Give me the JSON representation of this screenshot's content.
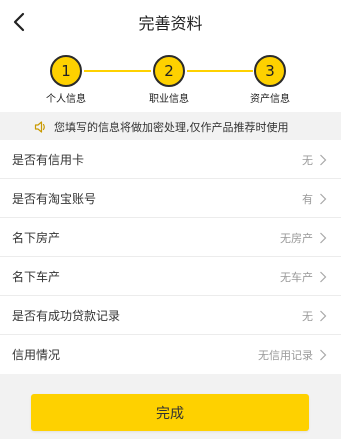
{
  "header": {
    "title": "完善资料",
    "back_icon": "chevron-left-icon"
  },
  "steps": [
    {
      "number": "1",
      "label": "个人信息"
    },
    {
      "number": "2",
      "label": "职业信息"
    },
    {
      "number": "3",
      "label": "资产信息"
    }
  ],
  "notice": {
    "icon": "speaker-icon",
    "text": "您填写的信息将做加密处理,仅作产品推荐时使用"
  },
  "fields": [
    {
      "label": "是否有信用卡",
      "value": "无"
    },
    {
      "label": "是否有淘宝账号",
      "value": "有"
    },
    {
      "label": "名下房产",
      "value": "无房产"
    },
    {
      "label": "名下车产",
      "value": "无车产"
    },
    {
      "label": "是否有成功贷款记录",
      "value": "无"
    },
    {
      "label": "信用情况",
      "value": "无信用记录"
    }
  ],
  "footer": {
    "done_label": "完成"
  },
  "colors": {
    "accent": "#fed100",
    "background": "#f2f2f2"
  }
}
